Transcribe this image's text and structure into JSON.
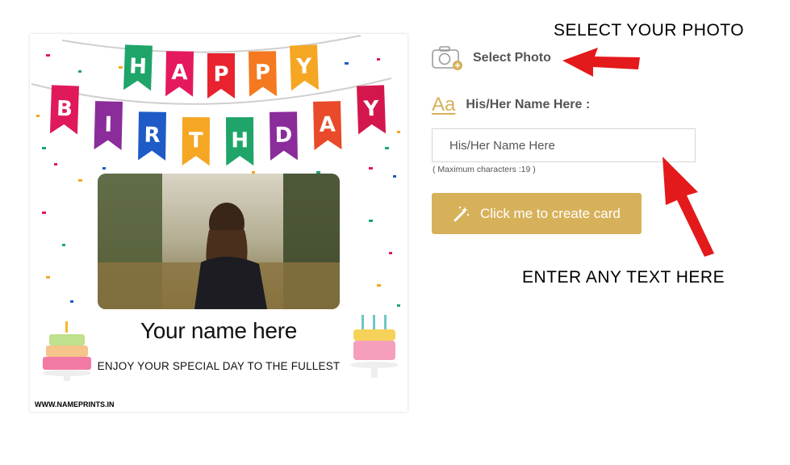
{
  "card": {
    "banner_top": [
      "H",
      "A",
      "P",
      "P",
      "Y"
    ],
    "banner_bottom": [
      "B",
      "I",
      "R",
      "T",
      "H",
      "D",
      "A",
      "Y"
    ],
    "name_text": "Your name here",
    "tagline": "ENJOY YOUR SPECIAL DAY TO THE FULLEST",
    "watermark": "WWW.NAMEPRINTS.IN",
    "pennant_colors": [
      "#1fa46a",
      "#e5195e",
      "#e8232f",
      "#f47920",
      "#f5a623",
      "#e0195b",
      "#8b2c9b",
      "#1e5bc6",
      "#f5a623",
      "#1fa46a",
      "#8b2c9b",
      "#e84a2a",
      "#d3174c"
    ]
  },
  "form": {
    "select_photo_label": "Select Photo",
    "name_label": "His/Her Name Here :",
    "name_icon_text": "Aa",
    "name_placeholder": "His/Her Name Here",
    "name_value": "",
    "max_hint": "( Maximum characters :19 )",
    "create_button_label": "Click me to create card",
    "accent_color": "#d7b15a"
  },
  "annotations": {
    "select_photo": "SELECT YOUR PHOTO",
    "enter_text": "ENTER ANY TEXT HERE",
    "arrow_color": "#e4191b"
  }
}
